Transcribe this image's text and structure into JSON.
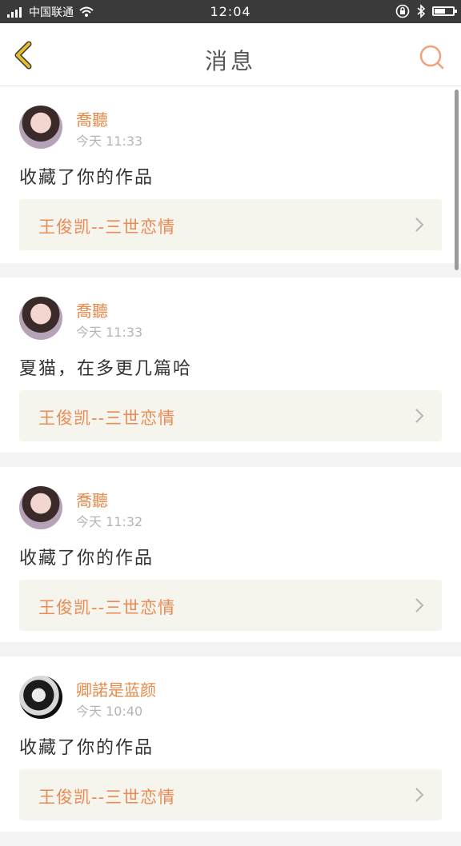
{
  "status_bar": {
    "carrier": "中国联通",
    "time": "12:04"
  },
  "header": {
    "title": "消息"
  },
  "messages": [
    {
      "username": "喬聽",
      "time": "今天 11:33",
      "text": "收藏了你的作品",
      "work_title": "王俊凯--三世恋情"
    },
    {
      "username": "喬聽",
      "time": "今天 11:33",
      "text": "夏猫，在多更几篇哈",
      "work_title": "王俊凯--三世恋情"
    },
    {
      "username": "喬聽",
      "time": "今天 11:32",
      "text": "收藏了你的作品",
      "work_title": "王俊凯--三世恋情"
    },
    {
      "username": "卿諾是蓝颜",
      "time": "今天 10:40",
      "text": "收藏了你的作品",
      "work_title": "王俊凯--三世恋情"
    }
  ],
  "colors": {
    "accent": "#e58a4a",
    "back_icon": "#e6c02b",
    "search_icon": "#f0a27a"
  }
}
